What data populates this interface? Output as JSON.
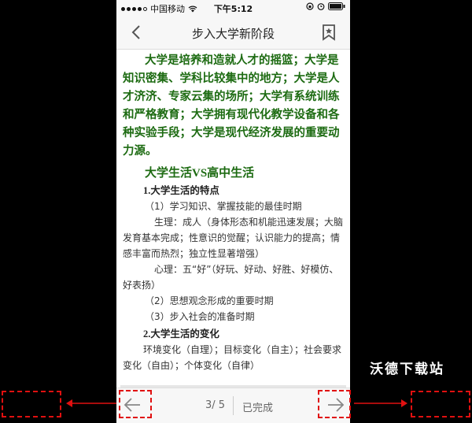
{
  "status_bar": {
    "carrier": "中国移动",
    "time": "下午5:12",
    "icons": [
      "signal-dots",
      "wifi-icon",
      "rotation-lock-icon",
      "alarm-icon",
      "battery-icon"
    ]
  },
  "nav": {
    "title": "步入大学新阶段",
    "back_icon": "chevron-left-icon",
    "bookmark_icon": "bookmark-icon"
  },
  "content": {
    "intro": "大学是培养和造就人才的摇篮；大学是知识密集、学科比较集中的地方；大学是人才济济、专家云集的场所；大学有系统训练和严格教育；大学拥有现代化教学设备和各种实验手段；大学是现代经济发展的重要动力源。",
    "section_title": "大学生活VS高中生活",
    "sub1": "1.大学生活的特点",
    "p1": "（1）学习知识、掌握技能的最佳时期",
    "p2": "生理：成人（身体形态和机能迅速发展；大脑发育基本完成；性意识的觉醒；认识能力的提高；情感丰富而热烈；独立性显著增强）",
    "p3": "心理：五“好”（好玩、好动、好胜、好模仿、好表扬）",
    "p4": "（2）思想观念形成的重要时期",
    "p5": "（3）步入社会的准备时期",
    "sub2": "2.大学生活的变化",
    "p6": "环境变化（自理）；目标变化（自主）；社会要求变化（自由）；个体变化（自律）"
  },
  "toolbar": {
    "page_indicator": "3/ 5",
    "status": "已完成",
    "prev_icon": "arrow-left-icon",
    "next_icon": "arrow-right-icon"
  },
  "watermark": "沃德下载站",
  "colors": {
    "accent_green": "#1d6b12",
    "annotation_red": "#e01010",
    "background": "#000000"
  }
}
